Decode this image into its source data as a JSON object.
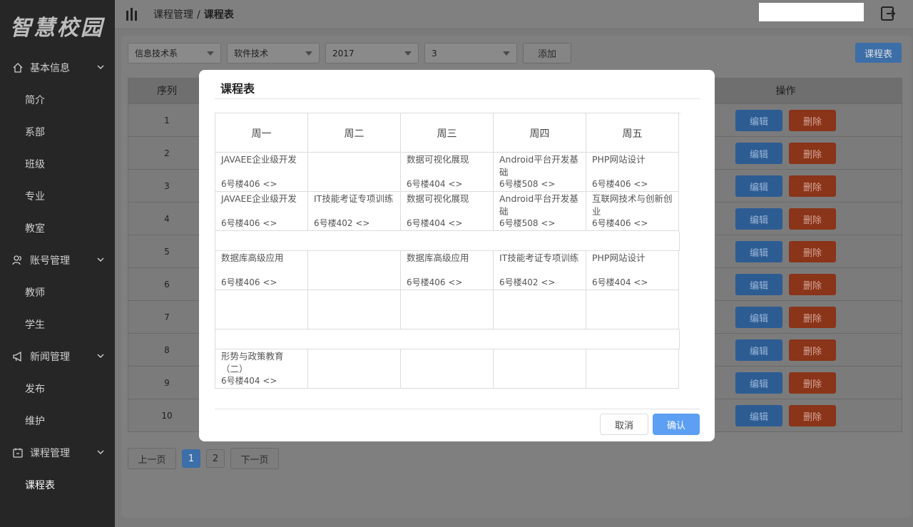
{
  "app": {
    "logo": "智慧校园"
  },
  "sidebar": {
    "groups": [
      {
        "label": "基本信息",
        "icon": "home-icon",
        "items": [
          "简介",
          "系部",
          "班级",
          "专业",
          "教室"
        ]
      },
      {
        "label": "账号管理",
        "icon": "users-icon",
        "items": [
          "教师",
          "学生"
        ]
      },
      {
        "label": "新闻管理",
        "icon": "megaphone-icon",
        "items": [
          "发布",
          "维护"
        ]
      },
      {
        "label": "课程管理",
        "icon": "calendar-icon",
        "items": [
          "课程表"
        ]
      }
    ]
  },
  "header": {
    "breadcrumb": {
      "parent": "课程管理",
      "separator": "/",
      "current": "课程表"
    }
  },
  "toolbar": {
    "department": "信息技术系",
    "major": "软件技术",
    "year": "2017",
    "class": "3",
    "add_label": "添加",
    "schedule_label": "课程表"
  },
  "table": {
    "headers": {
      "index": "序列",
      "actions": "操作"
    },
    "rows": [
      "1",
      "2",
      "3",
      "4",
      "5",
      "6",
      "7",
      "8",
      "9",
      "10"
    ],
    "edit_label": "编辑",
    "delete_label": "删除"
  },
  "pagination": {
    "prev": "上一页",
    "pages": [
      "1",
      "2"
    ],
    "current": "1",
    "next": "下一页"
  },
  "modal": {
    "title": "课程表",
    "days": [
      "周一",
      "周二",
      "周三",
      "周四",
      "周五"
    ],
    "slots": [
      [
        {
          "name": "JAVAEE企业级开发",
          "room": "6号楼406 <>"
        },
        {
          "name": "",
          "room": ""
        },
        {
          "name": "数据可视化展现",
          "room": "6号楼404 <>"
        },
        {
          "name": "Android平台开发基础",
          "room": "6号楼508 <>"
        },
        {
          "name": "PHP网站设计",
          "room": "6号楼406 <>"
        }
      ],
      [
        {
          "name": "JAVAEE企业级开发",
          "room": "6号楼406 <>"
        },
        {
          "name": "IT技能考证专项训练",
          "room": "6号楼402 <>"
        },
        {
          "name": "数据可视化展现",
          "room": "6号楼404 <>"
        },
        {
          "name": "Android平台开发基础",
          "room": "6号楼508 <>"
        },
        {
          "name": "互联网技术与创新创业",
          "room": "6号楼406 <>"
        }
      ],
      [
        {
          "name": "数据库高级应用",
          "room": "6号楼406 <>"
        },
        {
          "name": "",
          "room": ""
        },
        {
          "name": "数据库高级应用",
          "room": "6号楼406 <>"
        },
        {
          "name": "IT技能考证专项训练",
          "room": "6号楼402 <>"
        },
        {
          "name": "PHP网站设计",
          "room": "6号楼404 <>"
        }
      ],
      [
        {
          "name": "",
          "room": ""
        },
        {
          "name": "",
          "room": ""
        },
        {
          "name": "",
          "room": ""
        },
        {
          "name": "",
          "room": ""
        },
        {
          "name": "",
          "room": ""
        }
      ],
      [
        {
          "name": "形势与政策教育（二）",
          "room": "6号楼404 <>"
        },
        {
          "name": "",
          "room": ""
        },
        {
          "name": "",
          "room": ""
        },
        {
          "name": "",
          "room": ""
        },
        {
          "name": "",
          "room": ""
        }
      ]
    ],
    "cancel_label": "取消",
    "confirm_label": "确认"
  },
  "colors": {
    "primary": "#5c9ff3",
    "edit": "#2d5c93",
    "delete": "#8a3419",
    "sidebar": "#262626"
  }
}
